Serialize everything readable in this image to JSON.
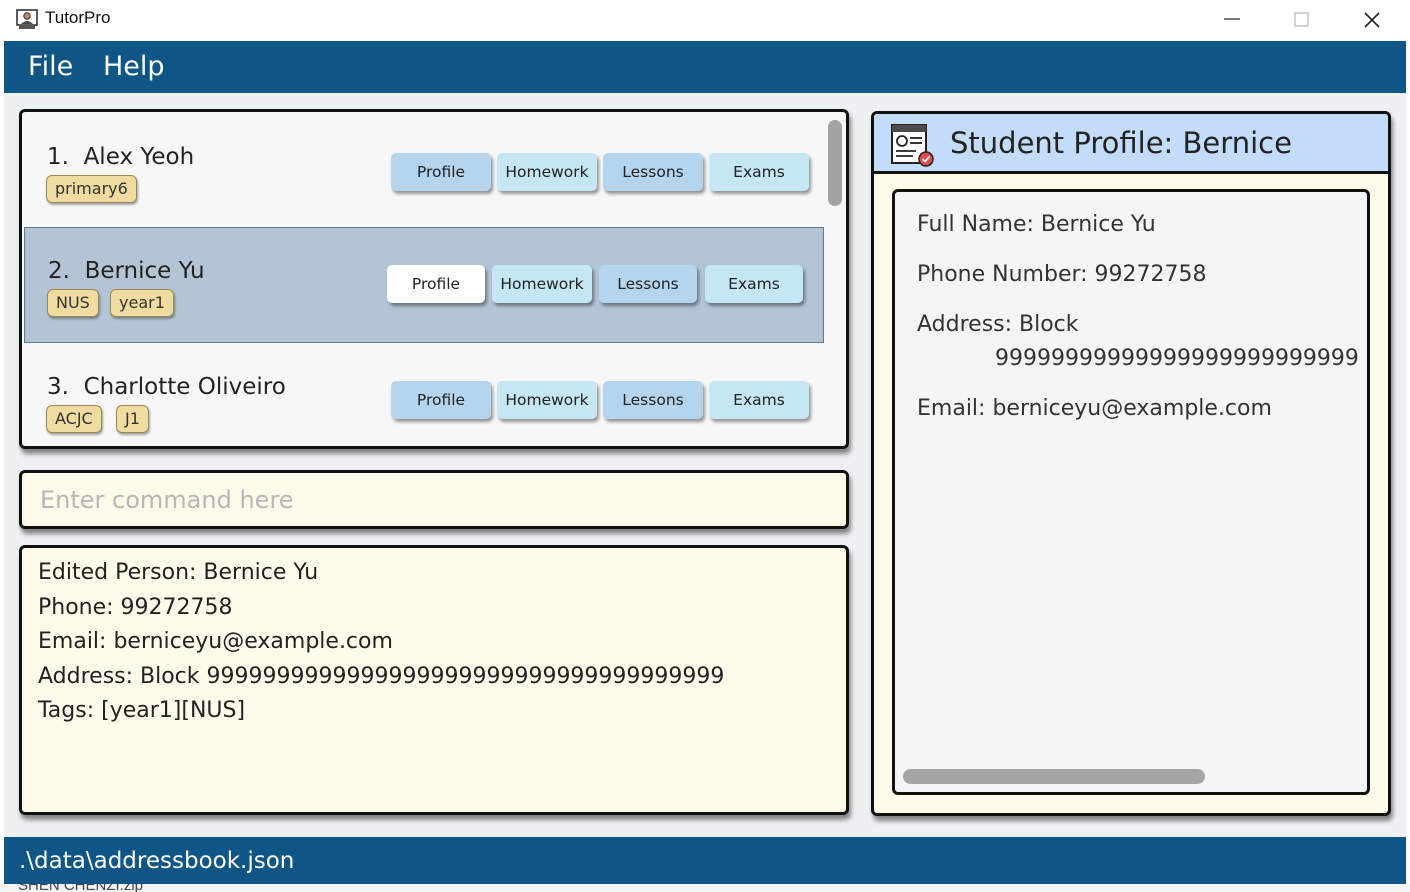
{
  "window": {
    "title": "TutorPro",
    "controls": [
      "minimize-icon",
      "maximize-icon",
      "close-icon"
    ]
  },
  "menu": {
    "file": "File",
    "help": "Help"
  },
  "students": [
    {
      "index": "1.",
      "name": "Alex Yeoh",
      "tags": [
        "primary6"
      ],
      "buttons": [
        "Profile",
        "Homework",
        "Lessons",
        "Exams"
      ]
    },
    {
      "index": "2.",
      "name": "Bernice Yu",
      "tags": [
        "NUS",
        "year1"
      ],
      "buttons": [
        "Profile",
        "Homework",
        "Lessons",
        "Exams"
      ],
      "selected": true
    },
    {
      "index": "3.",
      "name": "Charlotte Oliveiro",
      "tags": [
        "ACJC",
        "J1"
      ],
      "buttons": [
        "Profile",
        "Homework",
        "Lessons",
        "Exams"
      ]
    }
  ],
  "command": {
    "placeholder": "Enter command here",
    "value": ""
  },
  "result": {
    "lines": [
      "Edited Person: Bernice Yu",
      "Phone: 99272758",
      "Email: berniceyu@example.com",
      "Address: Block 9999999999999999999999999999999999999",
      "Tags: [year1][NUS]"
    ]
  },
  "profile": {
    "title": "Student Profile: Bernice",
    "full_name": "Full Name: Bernice Yu",
    "phone": "Phone Number: 99272758",
    "address_label": "Address: Block",
    "address_value": "99999999999999999999999999",
    "email": "Email: berniceyu@example.com"
  },
  "status": {
    "path": ".\\data\\addressbook.json"
  },
  "background_text": "SHEN CHENZI.zip",
  "colors": {
    "menubar": "#0f5585",
    "panel_bg": "#fffbea",
    "selected_card": "#b3c5d5",
    "tag_bg": "#f0dca0",
    "profile_header": "#c3dcfa"
  }
}
